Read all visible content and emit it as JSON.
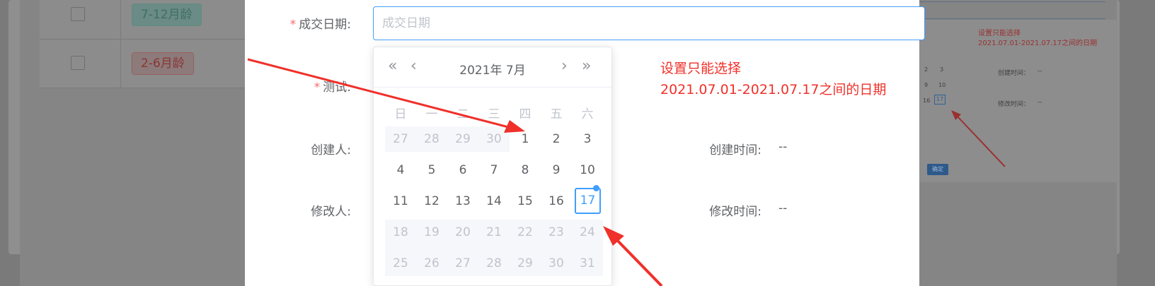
{
  "background": {
    "tags": [
      {
        "label": "7-12月龄",
        "kind": "green"
      },
      {
        "label": "2-6月龄",
        "kind": "red"
      }
    ],
    "thumbnail": {
      "note_line1": "设置只能选择",
      "note_line2": "2021.07.01-2021.07.17之间的日期",
      "created_time": "创建时间：",
      "modified_time": "修改时间：",
      "empty": "--",
      "today": "17",
      "confirm": "确定"
    }
  },
  "form": {
    "deal_date": {
      "label": "成交日期:",
      "placeholder": "成交日期",
      "required": "*"
    },
    "test": {
      "label": "测试:",
      "required": "*"
    },
    "creator": {
      "label": "创建人:"
    },
    "modifier": {
      "label": "修改人:"
    },
    "created_time": {
      "label": "创建时间:",
      "value": "--"
    },
    "modified_time": {
      "label": "修改时间:",
      "value": "--"
    }
  },
  "datepicker": {
    "title": "2021年 7月",
    "prev_year": "«",
    "prev_month": "‹",
    "next_month": "›",
    "next_year": "»",
    "weekdays": [
      "日",
      "一",
      "二",
      "三",
      "四",
      "五",
      "六"
    ],
    "weeks": [
      [
        "27",
        "28",
        "29",
        "30",
        "1",
        "2",
        "3"
      ],
      [
        "4",
        "5",
        "6",
        "7",
        "8",
        "9",
        "10"
      ],
      [
        "11",
        "12",
        "13",
        "14",
        "15",
        "16",
        "17"
      ],
      [
        "18",
        "19",
        "20",
        "21",
        "22",
        "23",
        "24"
      ],
      [
        "25",
        "26",
        "27",
        "28",
        "29",
        "30",
        "31"
      ]
    ],
    "today": "17"
  },
  "annotation": {
    "line1": "设置只能选择",
    "line2": "2021.07.01-2021.07.17之间的日期",
    "color": "#f0302a"
  },
  "colors": {
    "accent": "#409eff",
    "required": "#f56c6c"
  }
}
